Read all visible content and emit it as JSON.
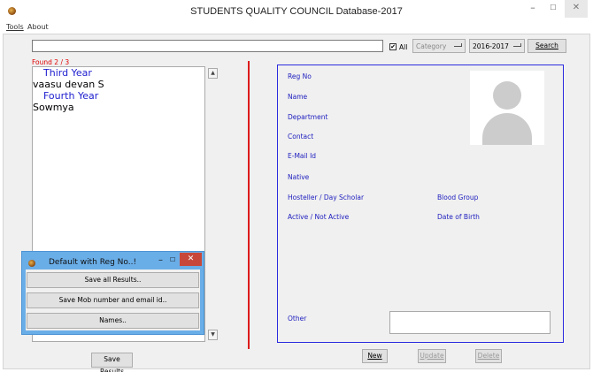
{
  "window": {
    "title": "STUDENTS QUALITY COUNCIL Database-2017",
    "minimize": "–",
    "maximize": "☐",
    "close": "✕"
  },
  "menu": {
    "tools": "Tools",
    "about": "About"
  },
  "search": {
    "value": "",
    "all_checkbox": {
      "label": "All",
      "checked": true,
      "mark": "✔"
    },
    "category_dropdown": "Category",
    "year_dropdown": "2016-2017",
    "search_button": "Search"
  },
  "results": {
    "found": "Found 2 / 3",
    "items": [
      {
        "text": "Third Year",
        "kind": "header"
      },
      {
        "text": "vaasu devan S",
        "kind": "name"
      },
      {
        "text": "Fourth Year",
        "kind": "header"
      },
      {
        "text": "Sowmya",
        "kind": "name"
      }
    ],
    "scroll_up": "▲",
    "scroll_down": "▼",
    "save_results_button": "Save Results"
  },
  "details": {
    "reg_no": "Reg No",
    "name": "Name",
    "department": "Department",
    "contact": "Contact",
    "email": "E-Mail Id",
    "native": "Native",
    "hosteller": "Hosteller / Day Scholar",
    "blood_group": "Blood Group",
    "active": "Active / Not Active",
    "dob": "Date of Birth",
    "other": "Other",
    "other_value": ""
  },
  "actions": {
    "new": "New",
    "update": "Update",
    "delete": "Delete"
  },
  "popup": {
    "title": "Default with Reg No..!",
    "minimize": "–",
    "maximize": "☐",
    "close": "✕",
    "buttons": [
      "Save all Results..",
      "Save Mob number and email id..",
      "Names.."
    ]
  },
  "colors": {
    "accent_blue": "#2020c0",
    "found_red": "#e00000",
    "divider_red": "#dd1c1c",
    "popup_frame": "#6aaee8",
    "popup_close": "#c7483a"
  },
  "icons": {
    "app": "app-icon",
    "photo": "user-placeholder-icon"
  }
}
